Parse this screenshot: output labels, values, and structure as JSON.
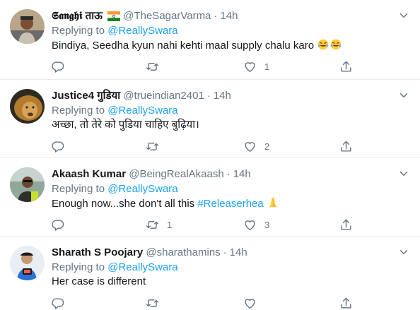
{
  "tweets": [
    {
      "name": "𝕾𝖆𝖓𝖌𝖍𝖎 ताऊ",
      "handle": "@TheSagarVarma",
      "dot": "·",
      "time": "14h",
      "replying_prefix": "Replying to",
      "replying_to": "@ReallySwara",
      "text": "Bindiya, Seedha kyun nahi kehti maal supply chalu karo",
      "reply_count": "",
      "retweet_count": "",
      "like_count": "1",
      "flag": "india-flag-emoji",
      "emoji": "rolling-laughing-emoji"
    },
    {
      "name": "Justice4 गुडिया",
      "handle": "@trueindian2401",
      "dot": "·",
      "time": "14h",
      "replying_prefix": "Replying to",
      "replying_to": "@ReallySwara",
      "text": "अच्छा, तो तेरे को पुडिया चाहिए बुढ़िया।",
      "reply_count": "",
      "retweet_count": "",
      "like_count": "2"
    },
    {
      "name": "Akaash Kumar",
      "handle": "@BeingRealAkaash",
      "dot": "·",
      "time": "14h",
      "replying_prefix": "Replying to",
      "replying_to": "@ReallySwara",
      "text_before": "Enough now...she don't all this ",
      "hashtag": "#Releaserhea",
      "reply_count": "",
      "retweet_count": "1",
      "like_count": "3",
      "emoji": "folded-hands-emoji"
    },
    {
      "name": "Sharath S Poojary",
      "handle": "@sharathamins",
      "dot": "·",
      "time": "14h",
      "replying_prefix": "Replying to",
      "replying_to": "@ReallySwara",
      "text": "Her case is different"
    }
  ],
  "colors": {
    "accent": "#1da1f2",
    "secondary_text": "#657786",
    "divider": "#e6ecf0",
    "icon": "#657786"
  }
}
